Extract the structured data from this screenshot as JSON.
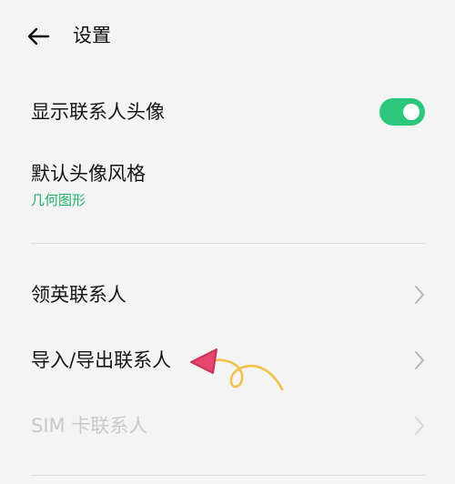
{
  "header": {
    "title": "设置",
    "back_icon": "arrow-left-icon"
  },
  "settings": {
    "show_avatar": {
      "label": "显示联系人头像",
      "enabled": true,
      "toggle_color": "#2bc77a"
    },
    "avatar_style": {
      "label": "默认头像风格",
      "value": "几何图形",
      "value_color": "#21b36b"
    },
    "linkedin": {
      "label": "领英联系人"
    },
    "import_export": {
      "label": "导入/导出联系人"
    },
    "sim": {
      "label": "SIM 卡联系人",
      "disabled": true
    }
  },
  "annotation": {
    "type": "hand-drawn-arrow",
    "arrow_color": "#e5476f",
    "tail_color": "#f0c24c"
  }
}
